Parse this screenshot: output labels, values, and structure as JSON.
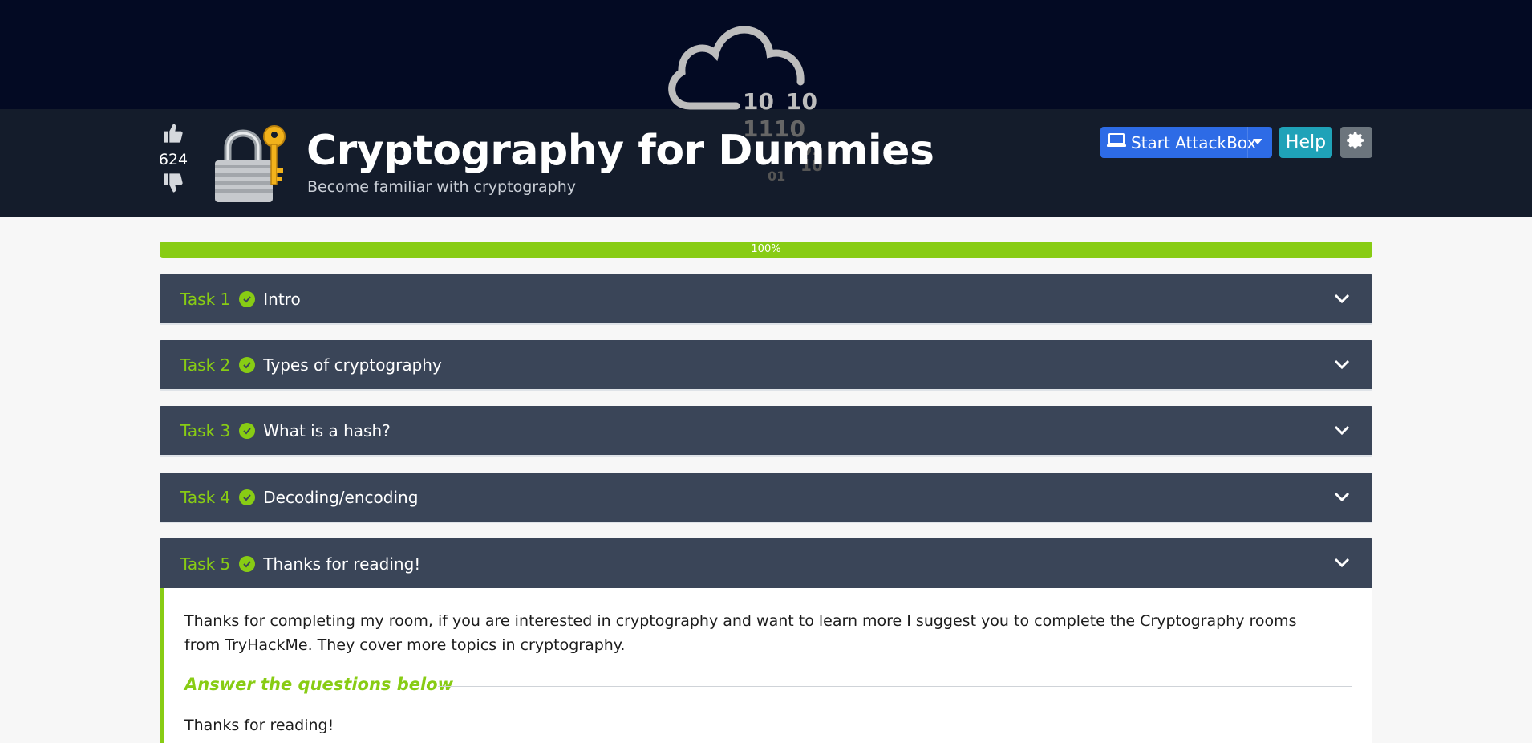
{
  "room": {
    "title": "Cryptography for Dummies",
    "subtitle": "Become familiar with cryptography",
    "vote_count": "624"
  },
  "logo": {
    "binary_lines": [
      "10",
      "10",
      "1110",
      "01",
      "10",
      "01"
    ]
  },
  "header_buttons": {
    "attackbox_label": "Start AttackBox",
    "help_label": "Help"
  },
  "progress": {
    "label": "100%",
    "value": 1.0
  },
  "tasks": [
    {
      "number": "Task 1",
      "title": "Intro"
    },
    {
      "number": "Task 2",
      "title": "Types of cryptography"
    },
    {
      "number": "Task 3",
      "title": "What is a hash?"
    },
    {
      "number": "Task 4",
      "title": "Decoding/encoding"
    },
    {
      "number": "Task 5",
      "title": "Thanks for reading!"
    }
  ],
  "open_task": {
    "paragraph": "Thanks for completing my room, if you are interested in cryptography and want to learn more I suggest you to complete the Cryptography rooms from TryHackMe. They cover more topics in cryptography.",
    "answer_heading": "Answer the questions below",
    "question": "Thanks for reading!"
  },
  "colors": {
    "accent": "#88cc14",
    "banner_dark": "#030a23",
    "header_bg": "#141c2b",
    "task_bg": "#3a4558",
    "attackbox_blue": "#2d6be6",
    "help_teal": "#1fa2b8"
  },
  "icons": [
    "thumbs-up-icon",
    "thumbs-down-icon",
    "padlock-key-icon",
    "laptop-icon",
    "gear-icon",
    "check-circle-icon",
    "chevron-down-icon",
    "cloud-icon"
  ]
}
